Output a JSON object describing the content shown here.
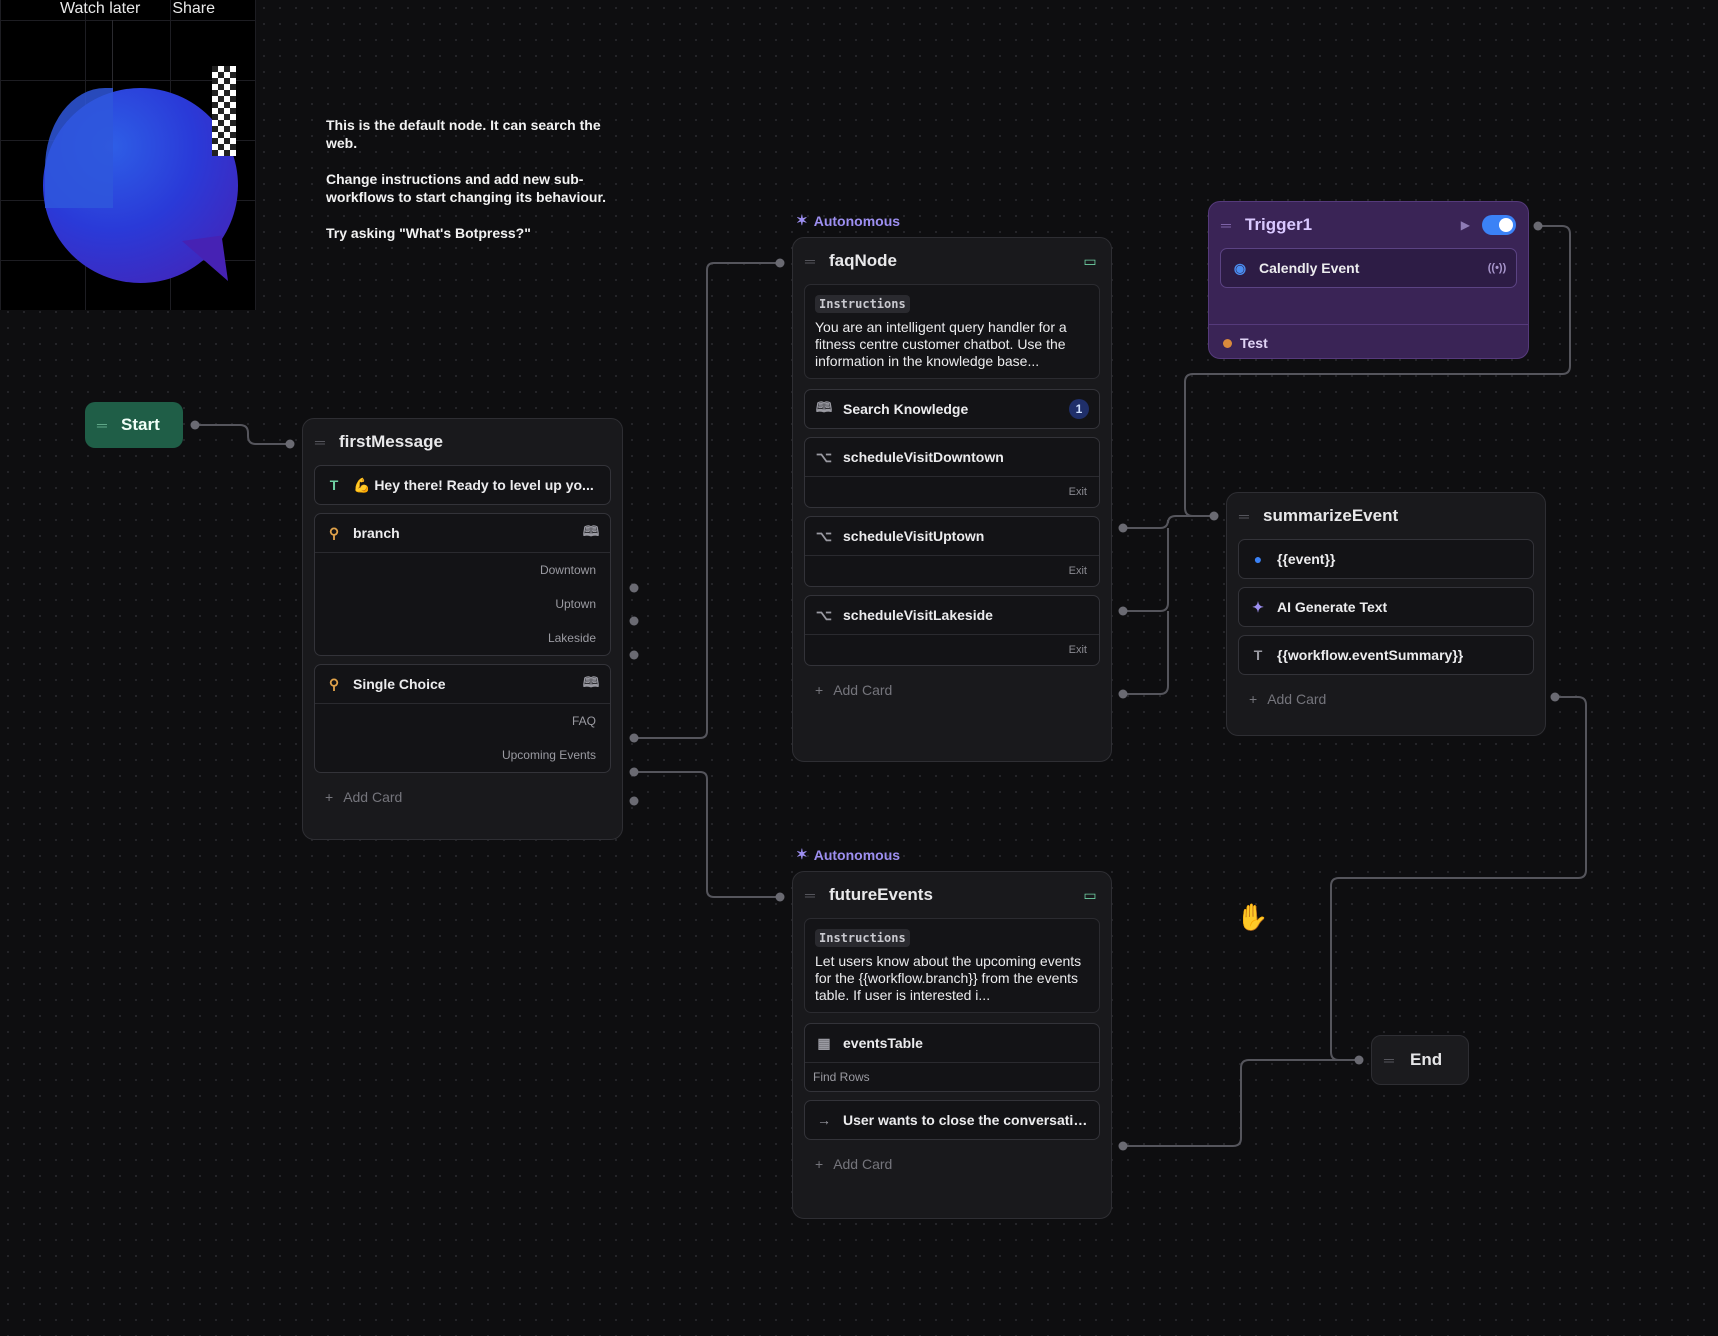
{
  "video_overlay": {
    "watch_later": "Watch later",
    "share": "Share"
  },
  "note": {
    "lines": [
      "This is the default node. It can search the web.",
      "Change instructions and add new sub-workflows to start changing its behaviour.",
      "Try asking \"What's Botpress?\""
    ]
  },
  "start_node": {
    "label": "Start"
  },
  "end_node": {
    "label": "End"
  },
  "first_message": {
    "title": "firstMessage",
    "text_card": "💪 Hey there! Ready to level up yo...",
    "branch_card": {
      "label": "branch",
      "options": [
        "Downtown",
        "Uptown",
        "Lakeside"
      ]
    },
    "choice_card": {
      "label": "Single Choice",
      "options": [
        "FAQ",
        "Upcoming Events"
      ]
    },
    "add_card": "Add Card"
  },
  "faq_node": {
    "badge": "Autonomous",
    "title": "faqNode",
    "instructions_tag": "Instructions",
    "instructions": "You are an intelligent query handler for a fitness centre customer chatbot. Use the information in the knowledge base...",
    "search_knowledge": {
      "label": "Search Knowledge",
      "count": "1"
    },
    "subflows": [
      {
        "label": "scheduleVisitDowntown",
        "exit": "Exit"
      },
      {
        "label": "scheduleVisitUptown",
        "exit": "Exit"
      },
      {
        "label": "scheduleVisitLakeside",
        "exit": "Exit"
      }
    ],
    "add_card": "Add Card"
  },
  "future_events": {
    "badge": "Autonomous",
    "title": "futureEvents",
    "instructions_tag": "Instructions",
    "instructions": "Let users know about the upcoming events for the {{workflow.branch}} from the events table. If user is interested i...",
    "table_card": {
      "label": "eventsTable",
      "sub": "Find Rows"
    },
    "transition": "User wants to close the conversation",
    "add_card": "Add Card"
  },
  "trigger": {
    "title": "Trigger1",
    "event": "Calendly Event",
    "test": "Test",
    "enabled": true
  },
  "summarize_event": {
    "title": "summarizeEvent",
    "cards": [
      "{{event}}",
      "AI Generate Text",
      "{{workflow.eventSummary}}"
    ],
    "add_card": "Add Card"
  },
  "colors": {
    "start": "#1f5e47",
    "trigger": "#3a2456",
    "autonomous": "#9d8ff0",
    "toggle": "#3b82f6"
  },
  "icons": [
    "drag-grip-icon",
    "text-icon",
    "branch-icon",
    "book-icon",
    "message-icon",
    "subflow-icon",
    "table-icon",
    "transition-icon",
    "calendly-icon",
    "ai-sparkle-icon",
    "play-icon",
    "hand-cursor-icon"
  ]
}
